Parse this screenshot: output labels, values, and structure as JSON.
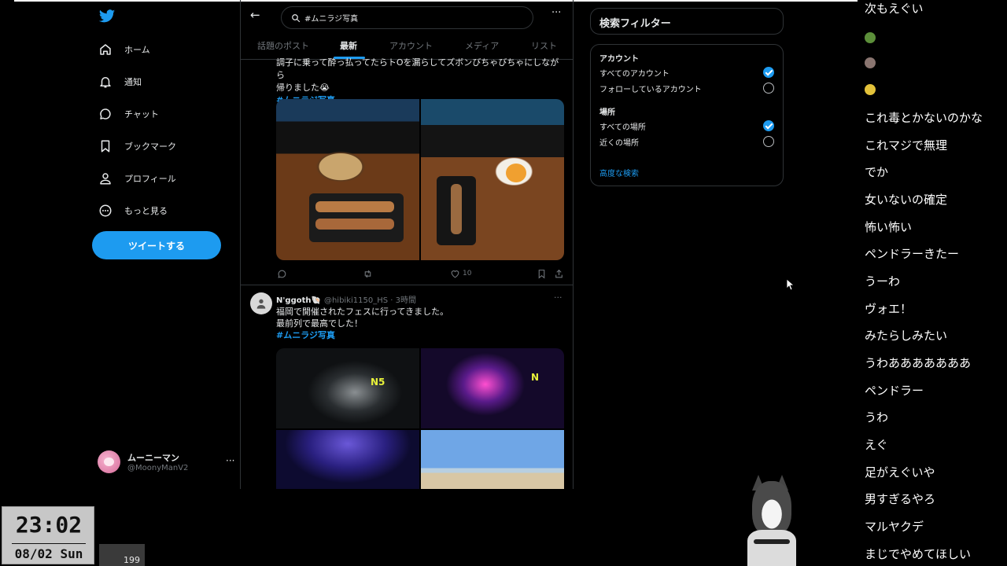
{
  "nav": {
    "items": [
      {
        "icon": "home-icon",
        "label": "ホーム"
      },
      {
        "icon": "bell-icon",
        "label": "通知"
      },
      {
        "icon": "chat-icon",
        "label": "チャット"
      },
      {
        "icon": "bookmark-icon",
        "label": "ブックマーク"
      },
      {
        "icon": "person-icon",
        "label": "プロフィール"
      },
      {
        "icon": "more-circle-icon",
        "label": "もっと見る"
      }
    ],
    "tweet_button": "ツイートする",
    "profile": {
      "name": "ムーニーマン",
      "handle": "@MoonyManV2",
      "more": "···"
    }
  },
  "search": {
    "query": "#ムニラジ写真",
    "more": "···"
  },
  "tabs": [
    {
      "label": "話題のポスト",
      "active": false
    },
    {
      "label": "最新",
      "active": true
    },
    {
      "label": "アカウント",
      "active": false
    },
    {
      "label": "メディア",
      "active": false
    },
    {
      "label": "リスト",
      "active": false
    }
  ],
  "tweet1": {
    "text_line1": "調子に乗って酔っ払ってたらトOを漏らしてズボンびちゃびちゃにしながら",
    "text_line2": "帰りました😭",
    "hashtag": "#ムニラジ写真",
    "likes": "10"
  },
  "tweet2": {
    "name": "N'ggoth🐚",
    "meta": "@hibiki1150_HS · 3時間",
    "more": "···",
    "line1": "福岡で開催されたフェスに行ってきました。",
    "line2": "最前列で最高でした！",
    "hashtag": "#ムニラジ写真"
  },
  "filter": {
    "title": "検索フィルター",
    "account_section": "アカウント",
    "account_options": [
      {
        "label": "すべてのアカウント",
        "checked": true
      },
      {
        "label": "フォローしているアカウント",
        "checked": false
      }
    ],
    "location_section": "場所",
    "location_options": [
      {
        "label": "すべての場所",
        "checked": true
      },
      {
        "label": "近くの場所",
        "checked": false
      }
    ],
    "advanced": "高度な検索"
  },
  "chat": {
    "messages": [
      "次もえぐい",
      "これ毒とかないのかな",
      "これマジで無理",
      "でか",
      "女いないの確定",
      "怖い怖い",
      "ペンドラーきたー",
      "うーわ",
      "ヴォエ！",
      "みたらしみたい",
      "うわあああああああ",
      "ペンドラー",
      "うわ",
      "えぐ",
      "足がえぐいや",
      "男すぎるやろ",
      "マルヤクデ",
      "まじでやめてほしい"
    ]
  },
  "clock": {
    "time": "23:02",
    "date": "08/02 Sun"
  },
  "counter": "199",
  "colors": {
    "accent": "#1d9bf0",
    "background": "#000000",
    "muted": "#71767b"
  }
}
